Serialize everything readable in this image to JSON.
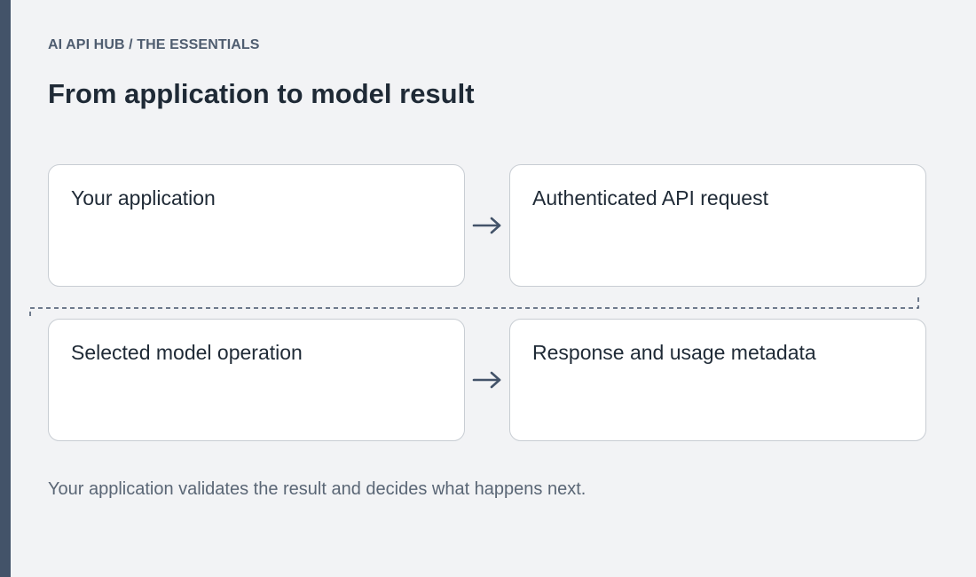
{
  "header": {
    "breadcrumb": "AI API HUB / THE ESSENTIALS",
    "title": "From application to model result"
  },
  "flow": {
    "steps": [
      {
        "label": "Your application",
        "icon": "none"
      },
      {
        "label": "Authenticated API request",
        "icon": "none"
      },
      {
        "label": "Selected model operation",
        "icon": "none"
      },
      {
        "label": "Response and usage metadata",
        "icon": "none"
      }
    ],
    "connectors": [
      "arrow-right-icon",
      "arrow-right-icon"
    ],
    "return_path": "dashed-return-line"
  },
  "footer": {
    "note": "Your application validates the result and decides what happens next."
  },
  "colors": {
    "background": "#f2f3f5",
    "rail": "#435369",
    "card": "#ffffff",
    "card_border": "#c8cdd3",
    "arrow": "#435369",
    "title_text": "#1f2a36",
    "muted_text": "#5a6675"
  }
}
